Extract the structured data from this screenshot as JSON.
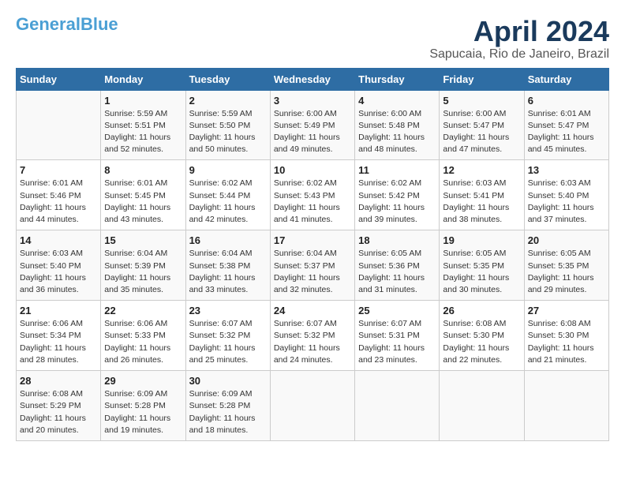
{
  "logo": {
    "part1": "General",
    "part2": "Blue"
  },
  "header": {
    "title": "April 2024",
    "location": "Sapucaia, Rio de Janeiro, Brazil"
  },
  "weekdays": [
    "Sunday",
    "Monday",
    "Tuesday",
    "Wednesday",
    "Thursday",
    "Friday",
    "Saturday"
  ],
  "weeks": [
    [
      {
        "day": "",
        "sunrise": "",
        "sunset": "",
        "daylight": ""
      },
      {
        "day": "1",
        "sunrise": "Sunrise: 5:59 AM",
        "sunset": "Sunset: 5:51 PM",
        "daylight": "Daylight: 11 hours and 52 minutes."
      },
      {
        "day": "2",
        "sunrise": "Sunrise: 5:59 AM",
        "sunset": "Sunset: 5:50 PM",
        "daylight": "Daylight: 11 hours and 50 minutes."
      },
      {
        "day": "3",
        "sunrise": "Sunrise: 6:00 AM",
        "sunset": "Sunset: 5:49 PM",
        "daylight": "Daylight: 11 hours and 49 minutes."
      },
      {
        "day": "4",
        "sunrise": "Sunrise: 6:00 AM",
        "sunset": "Sunset: 5:48 PM",
        "daylight": "Daylight: 11 hours and 48 minutes."
      },
      {
        "day": "5",
        "sunrise": "Sunrise: 6:00 AM",
        "sunset": "Sunset: 5:47 PM",
        "daylight": "Daylight: 11 hours and 47 minutes."
      },
      {
        "day": "6",
        "sunrise": "Sunrise: 6:01 AM",
        "sunset": "Sunset: 5:47 PM",
        "daylight": "Daylight: 11 hours and 45 minutes."
      }
    ],
    [
      {
        "day": "7",
        "sunrise": "Sunrise: 6:01 AM",
        "sunset": "Sunset: 5:46 PM",
        "daylight": "Daylight: 11 hours and 44 minutes."
      },
      {
        "day": "8",
        "sunrise": "Sunrise: 6:01 AM",
        "sunset": "Sunset: 5:45 PM",
        "daylight": "Daylight: 11 hours and 43 minutes."
      },
      {
        "day": "9",
        "sunrise": "Sunrise: 6:02 AM",
        "sunset": "Sunset: 5:44 PM",
        "daylight": "Daylight: 11 hours and 42 minutes."
      },
      {
        "day": "10",
        "sunrise": "Sunrise: 6:02 AM",
        "sunset": "Sunset: 5:43 PM",
        "daylight": "Daylight: 11 hours and 41 minutes."
      },
      {
        "day": "11",
        "sunrise": "Sunrise: 6:02 AM",
        "sunset": "Sunset: 5:42 PM",
        "daylight": "Daylight: 11 hours and 39 minutes."
      },
      {
        "day": "12",
        "sunrise": "Sunrise: 6:03 AM",
        "sunset": "Sunset: 5:41 PM",
        "daylight": "Daylight: 11 hours and 38 minutes."
      },
      {
        "day": "13",
        "sunrise": "Sunrise: 6:03 AM",
        "sunset": "Sunset: 5:40 PM",
        "daylight": "Daylight: 11 hours and 37 minutes."
      }
    ],
    [
      {
        "day": "14",
        "sunrise": "Sunrise: 6:03 AM",
        "sunset": "Sunset: 5:40 PM",
        "daylight": "Daylight: 11 hours and 36 minutes."
      },
      {
        "day": "15",
        "sunrise": "Sunrise: 6:04 AM",
        "sunset": "Sunset: 5:39 PM",
        "daylight": "Daylight: 11 hours and 35 minutes."
      },
      {
        "day": "16",
        "sunrise": "Sunrise: 6:04 AM",
        "sunset": "Sunset: 5:38 PM",
        "daylight": "Daylight: 11 hours and 33 minutes."
      },
      {
        "day": "17",
        "sunrise": "Sunrise: 6:04 AM",
        "sunset": "Sunset: 5:37 PM",
        "daylight": "Daylight: 11 hours and 32 minutes."
      },
      {
        "day": "18",
        "sunrise": "Sunrise: 6:05 AM",
        "sunset": "Sunset: 5:36 PM",
        "daylight": "Daylight: 11 hours and 31 minutes."
      },
      {
        "day": "19",
        "sunrise": "Sunrise: 6:05 AM",
        "sunset": "Sunset: 5:35 PM",
        "daylight": "Daylight: 11 hours and 30 minutes."
      },
      {
        "day": "20",
        "sunrise": "Sunrise: 6:05 AM",
        "sunset": "Sunset: 5:35 PM",
        "daylight": "Daylight: 11 hours and 29 minutes."
      }
    ],
    [
      {
        "day": "21",
        "sunrise": "Sunrise: 6:06 AM",
        "sunset": "Sunset: 5:34 PM",
        "daylight": "Daylight: 11 hours and 28 minutes."
      },
      {
        "day": "22",
        "sunrise": "Sunrise: 6:06 AM",
        "sunset": "Sunset: 5:33 PM",
        "daylight": "Daylight: 11 hours and 26 minutes."
      },
      {
        "day": "23",
        "sunrise": "Sunrise: 6:07 AM",
        "sunset": "Sunset: 5:32 PM",
        "daylight": "Daylight: 11 hours and 25 minutes."
      },
      {
        "day": "24",
        "sunrise": "Sunrise: 6:07 AM",
        "sunset": "Sunset: 5:32 PM",
        "daylight": "Daylight: 11 hours and 24 minutes."
      },
      {
        "day": "25",
        "sunrise": "Sunrise: 6:07 AM",
        "sunset": "Sunset: 5:31 PM",
        "daylight": "Daylight: 11 hours and 23 minutes."
      },
      {
        "day": "26",
        "sunrise": "Sunrise: 6:08 AM",
        "sunset": "Sunset: 5:30 PM",
        "daylight": "Daylight: 11 hours and 22 minutes."
      },
      {
        "day": "27",
        "sunrise": "Sunrise: 6:08 AM",
        "sunset": "Sunset: 5:30 PM",
        "daylight": "Daylight: 11 hours and 21 minutes."
      }
    ],
    [
      {
        "day": "28",
        "sunrise": "Sunrise: 6:08 AM",
        "sunset": "Sunset: 5:29 PM",
        "daylight": "Daylight: 11 hours and 20 minutes."
      },
      {
        "day": "29",
        "sunrise": "Sunrise: 6:09 AM",
        "sunset": "Sunset: 5:28 PM",
        "daylight": "Daylight: 11 hours and 19 minutes."
      },
      {
        "day": "30",
        "sunrise": "Sunrise: 6:09 AM",
        "sunset": "Sunset: 5:28 PM",
        "daylight": "Daylight: 11 hours and 18 minutes."
      },
      {
        "day": "",
        "sunrise": "",
        "sunset": "",
        "daylight": ""
      },
      {
        "day": "",
        "sunrise": "",
        "sunset": "",
        "daylight": ""
      },
      {
        "day": "",
        "sunrise": "",
        "sunset": "",
        "daylight": ""
      },
      {
        "day": "",
        "sunrise": "",
        "sunset": "",
        "daylight": ""
      }
    ]
  ]
}
